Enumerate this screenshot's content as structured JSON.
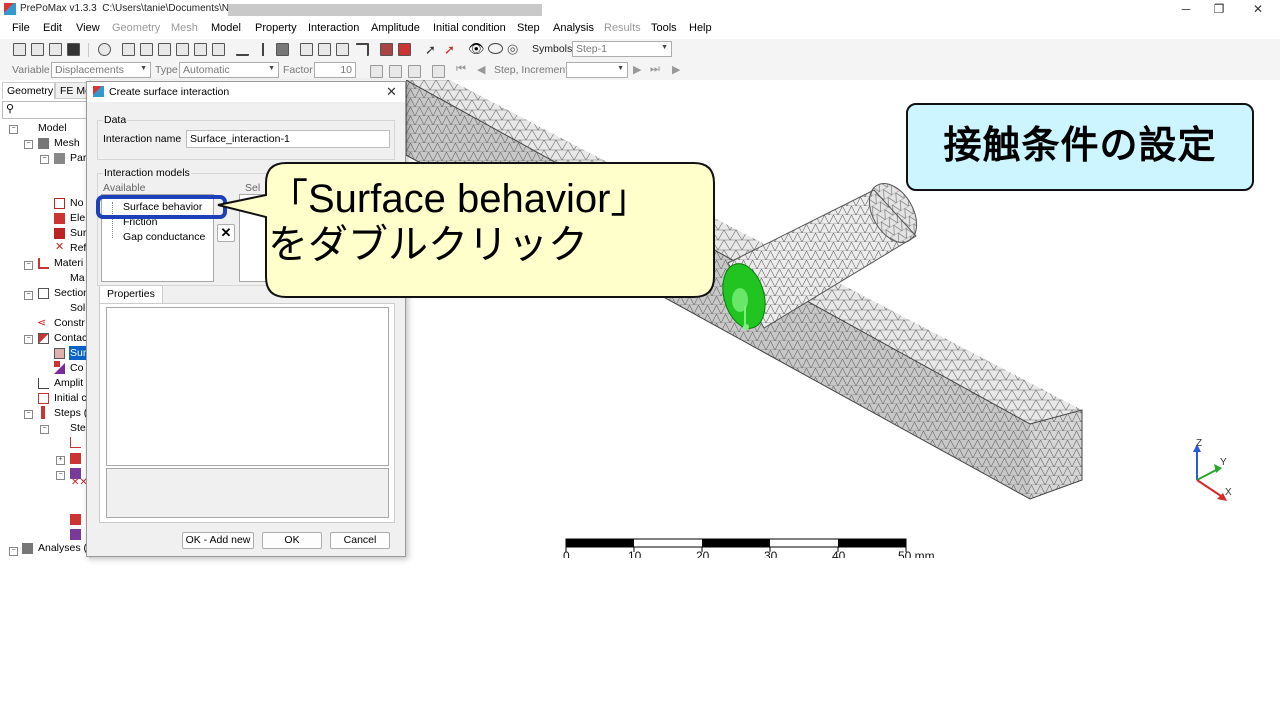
{
  "window": {
    "title": "PrePoMax v1.3.3",
    "path": "C:\\Users\\tanie\\Documents\\N",
    "controls": [
      "─",
      "❐",
      "✕"
    ]
  },
  "menubar": [
    {
      "label": "File",
      "enabled": true
    },
    {
      "label": "Edit",
      "enabled": true
    },
    {
      "label": "View",
      "enabled": true
    },
    {
      "label": "Geometry",
      "enabled": false
    },
    {
      "label": "Mesh",
      "enabled": false
    },
    {
      "label": "Model",
      "enabled": true
    },
    {
      "label": "Property",
      "enabled": true
    },
    {
      "label": "Interaction",
      "enabled": true
    },
    {
      "label": "Amplitude",
      "enabled": true
    },
    {
      "label": "Initial condition",
      "enabled": true
    },
    {
      "label": "Step",
      "enabled": true
    },
    {
      "label": "Analysis",
      "enabled": true
    },
    {
      "label": "Results",
      "enabled": false
    },
    {
      "label": "Tools",
      "enabled": true
    },
    {
      "label": "Help",
      "enabled": true
    }
  ],
  "toolbar1": {
    "symbols_label": "Symbols",
    "step_value": "Step-1"
  },
  "toolbar2": {
    "variable_label": "Variable",
    "variable_value": "Displacements",
    "type_label": "Type",
    "type_value": "Automatic",
    "factor_label": "Factor",
    "factor_value": "10",
    "increment_label": "Step, Increment"
  },
  "left_panel": {
    "tabs": [
      "Geometry",
      "FE Mo"
    ],
    "tree": [
      {
        "label": "Model",
        "level": 0
      },
      {
        "label": "Mesh",
        "level": 1
      },
      {
        "label": "Par",
        "level": 2
      },
      {
        "label": "No",
        "level": 2
      },
      {
        "label": "Ele",
        "level": 2
      },
      {
        "label": "Sur",
        "level": 2
      },
      {
        "label": "Ref",
        "level": 2
      },
      {
        "label": "Materi",
        "level": 1
      },
      {
        "label": "Ma",
        "level": 2
      },
      {
        "label": "Section",
        "level": 1
      },
      {
        "label": "Sol",
        "level": 2
      },
      {
        "label": "Constr",
        "level": 1
      },
      {
        "label": "Contac",
        "level": 1
      },
      {
        "label": "Sur",
        "level": 2,
        "selected": true
      },
      {
        "label": "Co",
        "level": 2
      },
      {
        "label": "Amplit",
        "level": 1
      },
      {
        "label": "Initial c",
        "level": 1
      },
      {
        "label": "Steps (",
        "level": 1
      },
      {
        "label": "Ste",
        "level": 2
      },
      {
        "label": "Analyses (",
        "level": 0
      }
    ]
  },
  "dialog": {
    "title": "Create surface interaction",
    "close": "✕",
    "data_group": "Data",
    "name_label": "Interaction name",
    "name_value": "Surface_interaction-1",
    "models_group": "Interaction models",
    "available_label": "Available",
    "selected_label": "Sel",
    "available_items": [
      "Surface behavior",
      "Friction",
      "Gap conductance"
    ],
    "remove_icon": "✕",
    "properties_tab": "Properties",
    "buttons": {
      "ok_add_new": "OK - Add new",
      "ok": "OK",
      "cancel": "Cancel"
    }
  },
  "annotations": {
    "title_box": "接触条件の設定",
    "bubble_line1": "「Surface behavior」",
    "bubble_line2": "をダブルクリック",
    "box_fill": "#ccf5ff",
    "bubble_fill": "#ffffcc",
    "highlight_color": "#1d3fb8"
  },
  "scale_bar": {
    "labels": [
      "0",
      "10",
      "20",
      "30",
      "40",
      "50 mm"
    ]
  },
  "axes_triad": {
    "z": "Z",
    "y": "Y",
    "x": "X"
  }
}
